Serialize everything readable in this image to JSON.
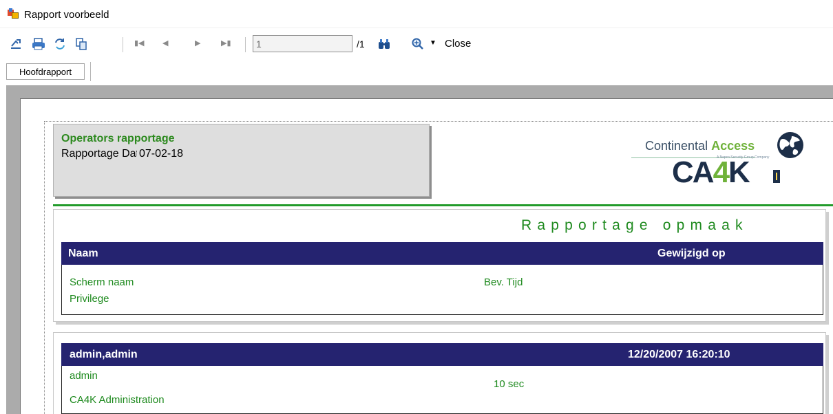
{
  "window": {
    "title": "Rapport voorbeeld",
    "icon": "report-viewer-app-icon"
  },
  "toolbar": {
    "export_icon": "export-icon",
    "print_icon": "printer-icon",
    "refresh_icon": "refresh-icon",
    "copy_icon": "copy-icon",
    "first_icon": "first-page-icon",
    "prev_icon": "previous-page-icon",
    "next_icon": "next-page-icon",
    "last_icon": "last-page-icon",
    "page_value": "1",
    "page_total": "/1",
    "search_icon": "binoculars-icon",
    "zoom_icon": "zoom-icon",
    "close_label": "Close"
  },
  "tabs": [
    {
      "label": "Hoofdrapport"
    }
  ],
  "report": {
    "title": "Operators rapportage",
    "date_label": "Rapportage Datum",
    "date_value": "07-02-18",
    "logo": {
      "name": "Continental",
      "name_accent": "Access",
      "tagline": "A Napco Security Group Company",
      "product_prefix": "CA",
      "product_accent": "4",
      "product_suffix": "K"
    },
    "layout_section": {
      "title": "Rapportage opmaak",
      "header": {
        "col1": "Naam",
        "col2": "Gewijzigd op"
      },
      "row": {
        "screen": "Scherm naam",
        "privilege": "Privilege",
        "time": "Bev. Tijd"
      }
    },
    "records": [
      {
        "name": "admin,admin",
        "modified": "12/20/2007 16:20:10",
        "screen": "admin",
        "privilege": "CA4K Administration",
        "time": "10  sec"
      }
    ]
  },
  "colors": {
    "header_bar": "#252370",
    "green_text": "#1e8a1e",
    "viewer_background": "#ababab"
  }
}
